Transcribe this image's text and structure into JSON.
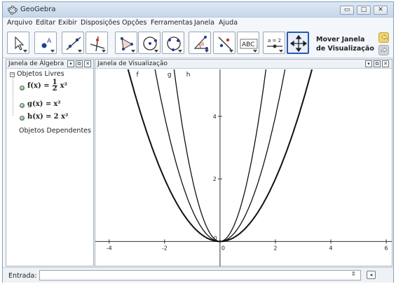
{
  "window": {
    "title": "GeoGebra"
  },
  "menu": [
    "Arquivo",
    "Editar",
    "Exibir",
    "Disposições",
    "Opções",
    "Ferramentas",
    "Janela",
    "Ajuda"
  ],
  "toolbar": {
    "tools": [
      "move-tool",
      "point-tool",
      "line-tool",
      "perpendicular-line-tool",
      "polygon-tool",
      "circle-tool",
      "conic-tool",
      "angle-tool",
      "reflect-tool",
      "text-tool",
      "slider-tool",
      "move-graphics-view-tool"
    ],
    "text_tool_label": "ABC",
    "slider_tool_label": "a = 2",
    "help_line1": "Mover Janela",
    "help_line2": "de Visualização"
  },
  "algebra": {
    "title": "Janela de Álgebra",
    "free_objects": "Objetos Livres",
    "dependent_objects": "Objetos Dependentes",
    "functions": [
      {
        "name": "f(x) =",
        "coef_num": "1",
        "coef_den": "2",
        "expr": "x²"
      },
      {
        "name": "g(x) =",
        "coef_num": "",
        "coef_den": "",
        "expr": "x²"
      },
      {
        "name": "h(x) =",
        "coef_num": "",
        "coef_den": "",
        "expr": "2 x²"
      }
    ]
  },
  "graphics": {
    "title": "Janela de Visualização"
  },
  "input": {
    "label": "Entrada:"
  },
  "chart_data": {
    "type": "line",
    "title": "",
    "xlabel": "",
    "ylabel": "",
    "xlim": [
      -4.5,
      6.2
    ],
    "ylim": [
      -0.8,
      5.5
    ],
    "x_ticks": [
      -4,
      -2,
      0,
      2,
      4,
      6
    ],
    "y_ticks": [
      2,
      4
    ],
    "origin_y_label": "0",
    "grid": false,
    "series": [
      {
        "name": "f",
        "formula": "0.5*x^2",
        "label_x": -3.12
      },
      {
        "name": "g",
        "formula": "x^2",
        "label_x": -2.0
      },
      {
        "name": "h",
        "formula": "2*x^2",
        "label_x": -1.32
      }
    ]
  }
}
